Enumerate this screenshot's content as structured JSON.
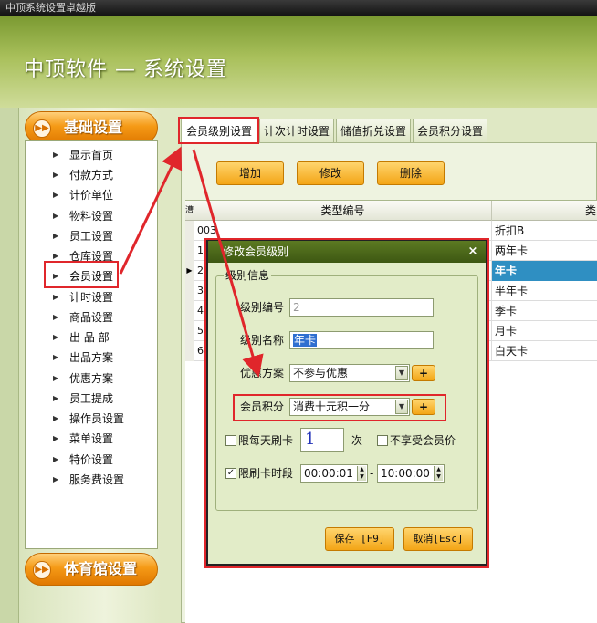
{
  "window": {
    "title": "中顶系统设置卓越版"
  },
  "header": {
    "app_title": "中顶软件 — 系统设置"
  },
  "sidebar": {
    "category_top": "基础设置",
    "category_bottom": "体育馆设置",
    "items": [
      "显示首页",
      "付款方式",
      "计价单位",
      "物料设置",
      "员工设置",
      "仓库设置",
      "会员设置",
      "计时设置",
      "商品设置",
      "出 品 部",
      "出品方案",
      "优惠方案",
      "员工提成",
      "操作员设置",
      "菜单设置",
      "特价设置",
      "服务费设置"
    ],
    "selected_item": "会员设置"
  },
  "tabs": [
    "会员级别设置",
    "计次计时设置",
    "储值折兑设置",
    "会员积分设置"
  ],
  "toolbar": {
    "add": "增加",
    "edit": "修改",
    "delete": "删除"
  },
  "grid": {
    "columns": {
      "indicator": "漕",
      "type_id": "类型编号",
      "name": "折扣B",
      "extra": "类"
    },
    "rows": [
      {
        "id": "003",
        "name": "两年卡",
        "selected": false
      },
      {
        "id": "1",
        "name": "年卡",
        "selected": true
      },
      {
        "id": "2",
        "name": "半年卡",
        "selected": false
      },
      {
        "id": "3",
        "name": "季卡",
        "selected": false
      },
      {
        "id": "4",
        "name": "月卡",
        "selected": false
      },
      {
        "id": "5",
        "name": "白天卡",
        "selected": false
      },
      {
        "id": "6",
        "name": "",
        "selected": false
      }
    ],
    "row_markers": [
      "003",
      "1",
      "2",
      "3",
      "4",
      "5",
      "6"
    ]
  },
  "dialog": {
    "title": "修改会员级别",
    "close": "×",
    "group_label": "级别信息",
    "level_id_label": "级别编号",
    "level_id_value": "2",
    "level_name_label": "级别名称",
    "level_name_value": "年卡",
    "discount_label": "优惠方案",
    "discount_value": "不参与优惠",
    "points_label": "会员积分",
    "points_value": "消费十元积一分",
    "plus": "+",
    "daily_limit_label": "限每天刷卡",
    "daily_limit_value": "1",
    "daily_limit_unit": "次",
    "no_member_price_label": "不享受会员价",
    "time_limit_label": "限刷卡时段",
    "time_start": "00:00:01",
    "time_sep": "-",
    "time_end": "10:00:00",
    "save_label": "保存 [F9]",
    "cancel_label": "取消[Esc]"
  },
  "colors": {
    "accent_orange": "#f59a16",
    "highlight_red": "#e0262b",
    "selection_blue": "#2f8fc2",
    "header_green": "#7b9a32"
  },
  "icons": {
    "category": "circle-arrow-icon",
    "menu_bullet": "triangle-right-icon",
    "row_pointer": "row-pointer-icon"
  }
}
